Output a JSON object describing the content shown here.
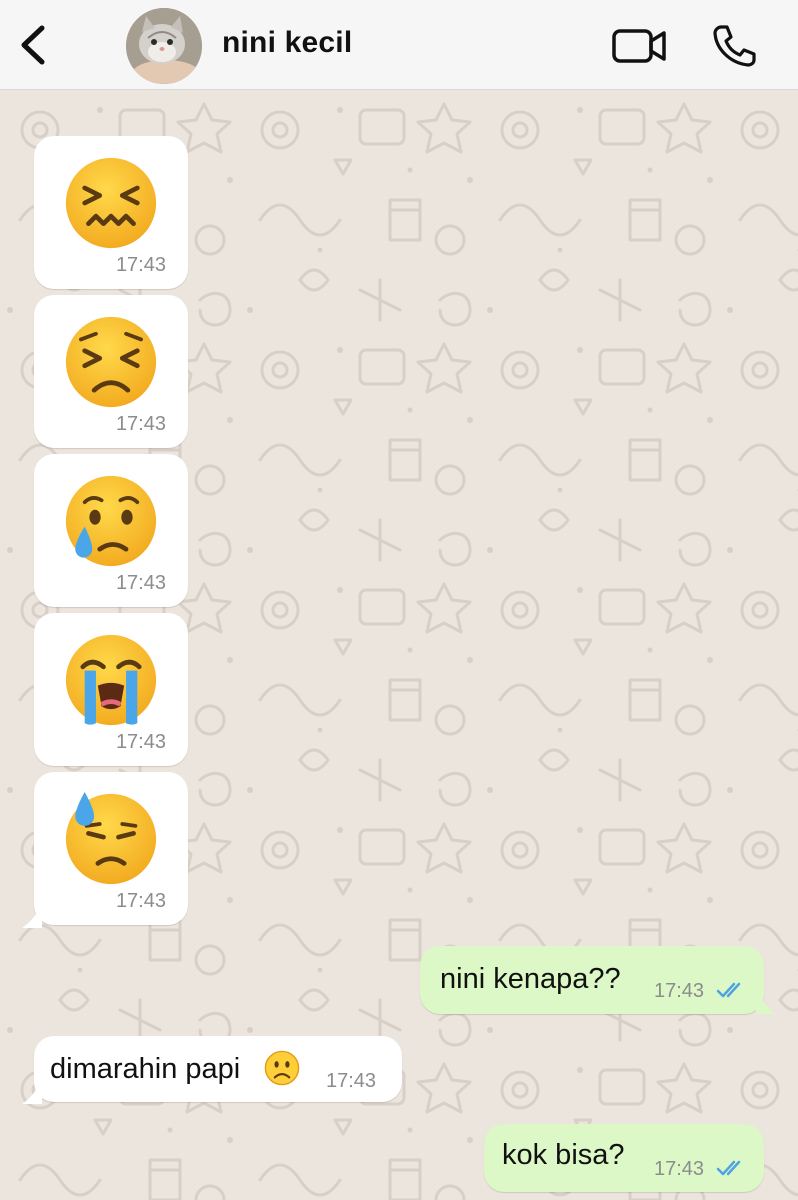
{
  "header": {
    "contact_name": "nini kecil",
    "back_icon": "chevron-left-icon",
    "video_icon": "video-camera-icon",
    "call_icon": "phone-icon"
  },
  "colors": {
    "header_bg": "#f6f6f6",
    "chat_bg": "#ece5dd",
    "incoming_bubble": "#ffffff",
    "outgoing_bubble": "#dcf8c6",
    "timestamp": "#8c8c8c",
    "read_ticks": "#4fa3e3"
  },
  "messages": [
    {
      "direction": "incoming",
      "type": "emoji",
      "emoji": "confounded-face",
      "time": "17:43"
    },
    {
      "direction": "incoming",
      "type": "emoji",
      "emoji": "persevering-face",
      "time": "17:43"
    },
    {
      "direction": "incoming",
      "type": "emoji",
      "emoji": "crying-face",
      "time": "17:43"
    },
    {
      "direction": "incoming",
      "type": "emoji",
      "emoji": "loudly-crying-face",
      "time": "17:43"
    },
    {
      "direction": "incoming",
      "type": "emoji",
      "emoji": "downcast-face-with-sweat",
      "time": "17:43"
    },
    {
      "direction": "outgoing",
      "type": "text",
      "text": "nini kenapa??",
      "time": "17:43",
      "status": "read"
    },
    {
      "direction": "incoming",
      "type": "text",
      "text": "dimarahin papi",
      "emoji": "frowning-face",
      "time": "17:43"
    },
    {
      "direction": "outgoing",
      "type": "text",
      "text": "kok bisa?",
      "time": "17:43",
      "status": "read"
    }
  ]
}
